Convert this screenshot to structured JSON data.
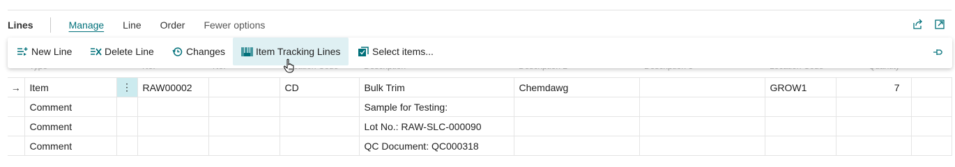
{
  "part": {
    "title": "Lines",
    "tabs": [
      "Manage",
      "Line",
      "Order",
      "Fewer options"
    ],
    "active_tab": "Manage",
    "icons": [
      "share-icon",
      "expand-icon"
    ]
  },
  "actions": {
    "new_line": "New Line",
    "delete_line": "Delete Line",
    "changes": "Changes",
    "item_tracking_lines": "Item Tracking Lines",
    "select_items": "Select items...",
    "pin_icon": "pin-icon"
  },
  "columns": {
    "type": "Type",
    "no": "No.",
    "no2": "No.",
    "location_code": "Location Code",
    "description": "Description",
    "description2": "Description 2",
    "description3": "Description 3",
    "location_code2": "Location Code",
    "quantity": "Quantity"
  },
  "rows": [
    {
      "marker": "→",
      "type": "Item",
      "no": "RAW00002",
      "code": "CD",
      "description": "Bulk Trim",
      "description2": "Chemdawg",
      "location": "GROW1",
      "quantity": "7"
    },
    {
      "marker": "",
      "type": "Comment",
      "no": "",
      "code": "",
      "description": "Sample for Testing:",
      "description2": "",
      "location": "",
      "quantity": ""
    },
    {
      "marker": "",
      "type": "Comment",
      "no": "",
      "code": "",
      "description": "Lot No.: RAW-SLC-000090",
      "description2": "",
      "location": "",
      "quantity": ""
    },
    {
      "marker": "",
      "type": "Comment",
      "no": "",
      "code": "",
      "description": "QC Document: QC000318",
      "description2": "",
      "location": "",
      "quantity": ""
    }
  ],
  "colors": {
    "accent": "#00707a",
    "highlight": "#dff0f3",
    "selected_cell": "#ccebef"
  }
}
